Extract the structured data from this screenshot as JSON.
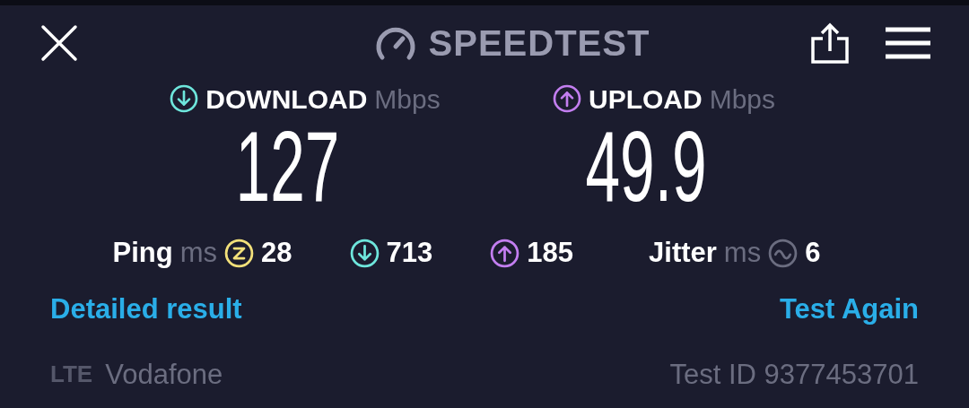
{
  "header": {
    "title": "SPEEDTEST"
  },
  "metrics": [
    {
      "kind": "download",
      "label": "DOWNLOAD",
      "unit": "Mbps",
      "value": "127",
      "color": "#6ee6dc"
    },
    {
      "kind": "upload",
      "label": "UPLOAD",
      "unit": "Mbps",
      "value": "49.9",
      "color": "#c37ef0"
    }
  ],
  "stats": [
    {
      "kind": "ping",
      "label": "Ping",
      "unit": "ms",
      "value": "28",
      "color": "#f2e07a"
    },
    {
      "kind": "download",
      "value": "713",
      "color": "#6ee6dc"
    },
    {
      "kind": "upload",
      "value": "185",
      "color": "#c37ef0"
    },
    {
      "kind": "jitter",
      "label": "Jitter",
      "unit": "ms",
      "value": "6",
      "color": "#6b6d80"
    }
  ],
  "links": [
    "Detailed result",
    "Test Again"
  ],
  "footer": {
    "network_type": "LTE",
    "carrier": "Vodafone",
    "test_id": "Test ID 9377453701"
  }
}
